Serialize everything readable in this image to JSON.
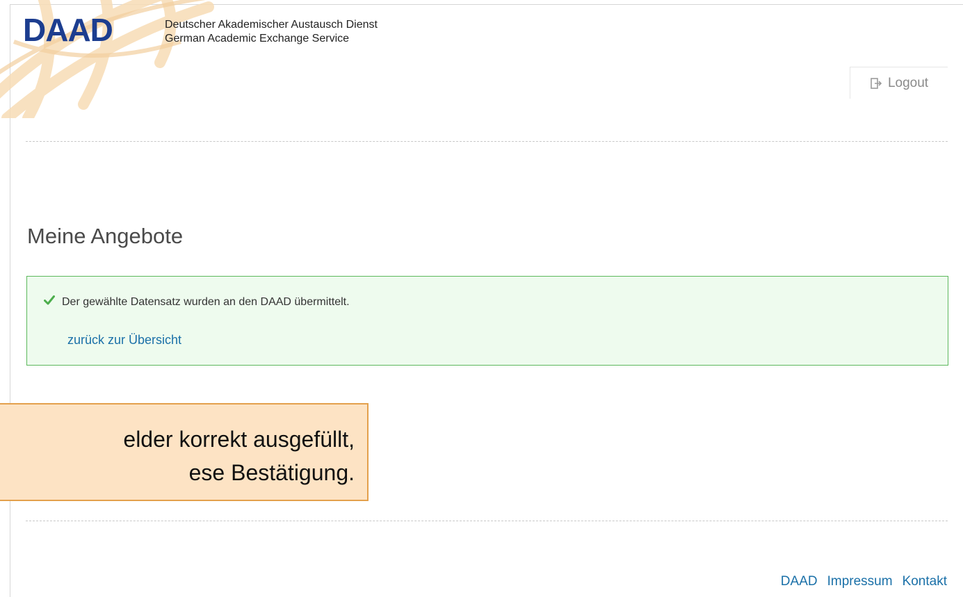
{
  "header": {
    "logo_text": "DAAD",
    "org_name_de": "Deutscher Akademischer Austausch Dienst",
    "org_name_en": "German Academic Exchange Service",
    "logout_label": "Logout"
  },
  "main": {
    "title": "Meine Angebote",
    "alert": {
      "message": "Der gewählte Datensatz wurden an den DAAD übermittelt.",
      "back_link": "zurück zur Übersicht"
    }
  },
  "callout": {
    "line1": "elder korrekt ausgefüllt,",
    "line2": "ese Bestätigung."
  },
  "footer": {
    "links": [
      "DAAD",
      "Impressum",
      "Kontakt"
    ]
  },
  "colors": {
    "brand": "#1c3d8f",
    "success_border": "#5cb85c",
    "success_bg": "#eefbee",
    "link": "#1a70a8",
    "callout_bg": "#fde3c4",
    "callout_border": "#e3a04c"
  }
}
